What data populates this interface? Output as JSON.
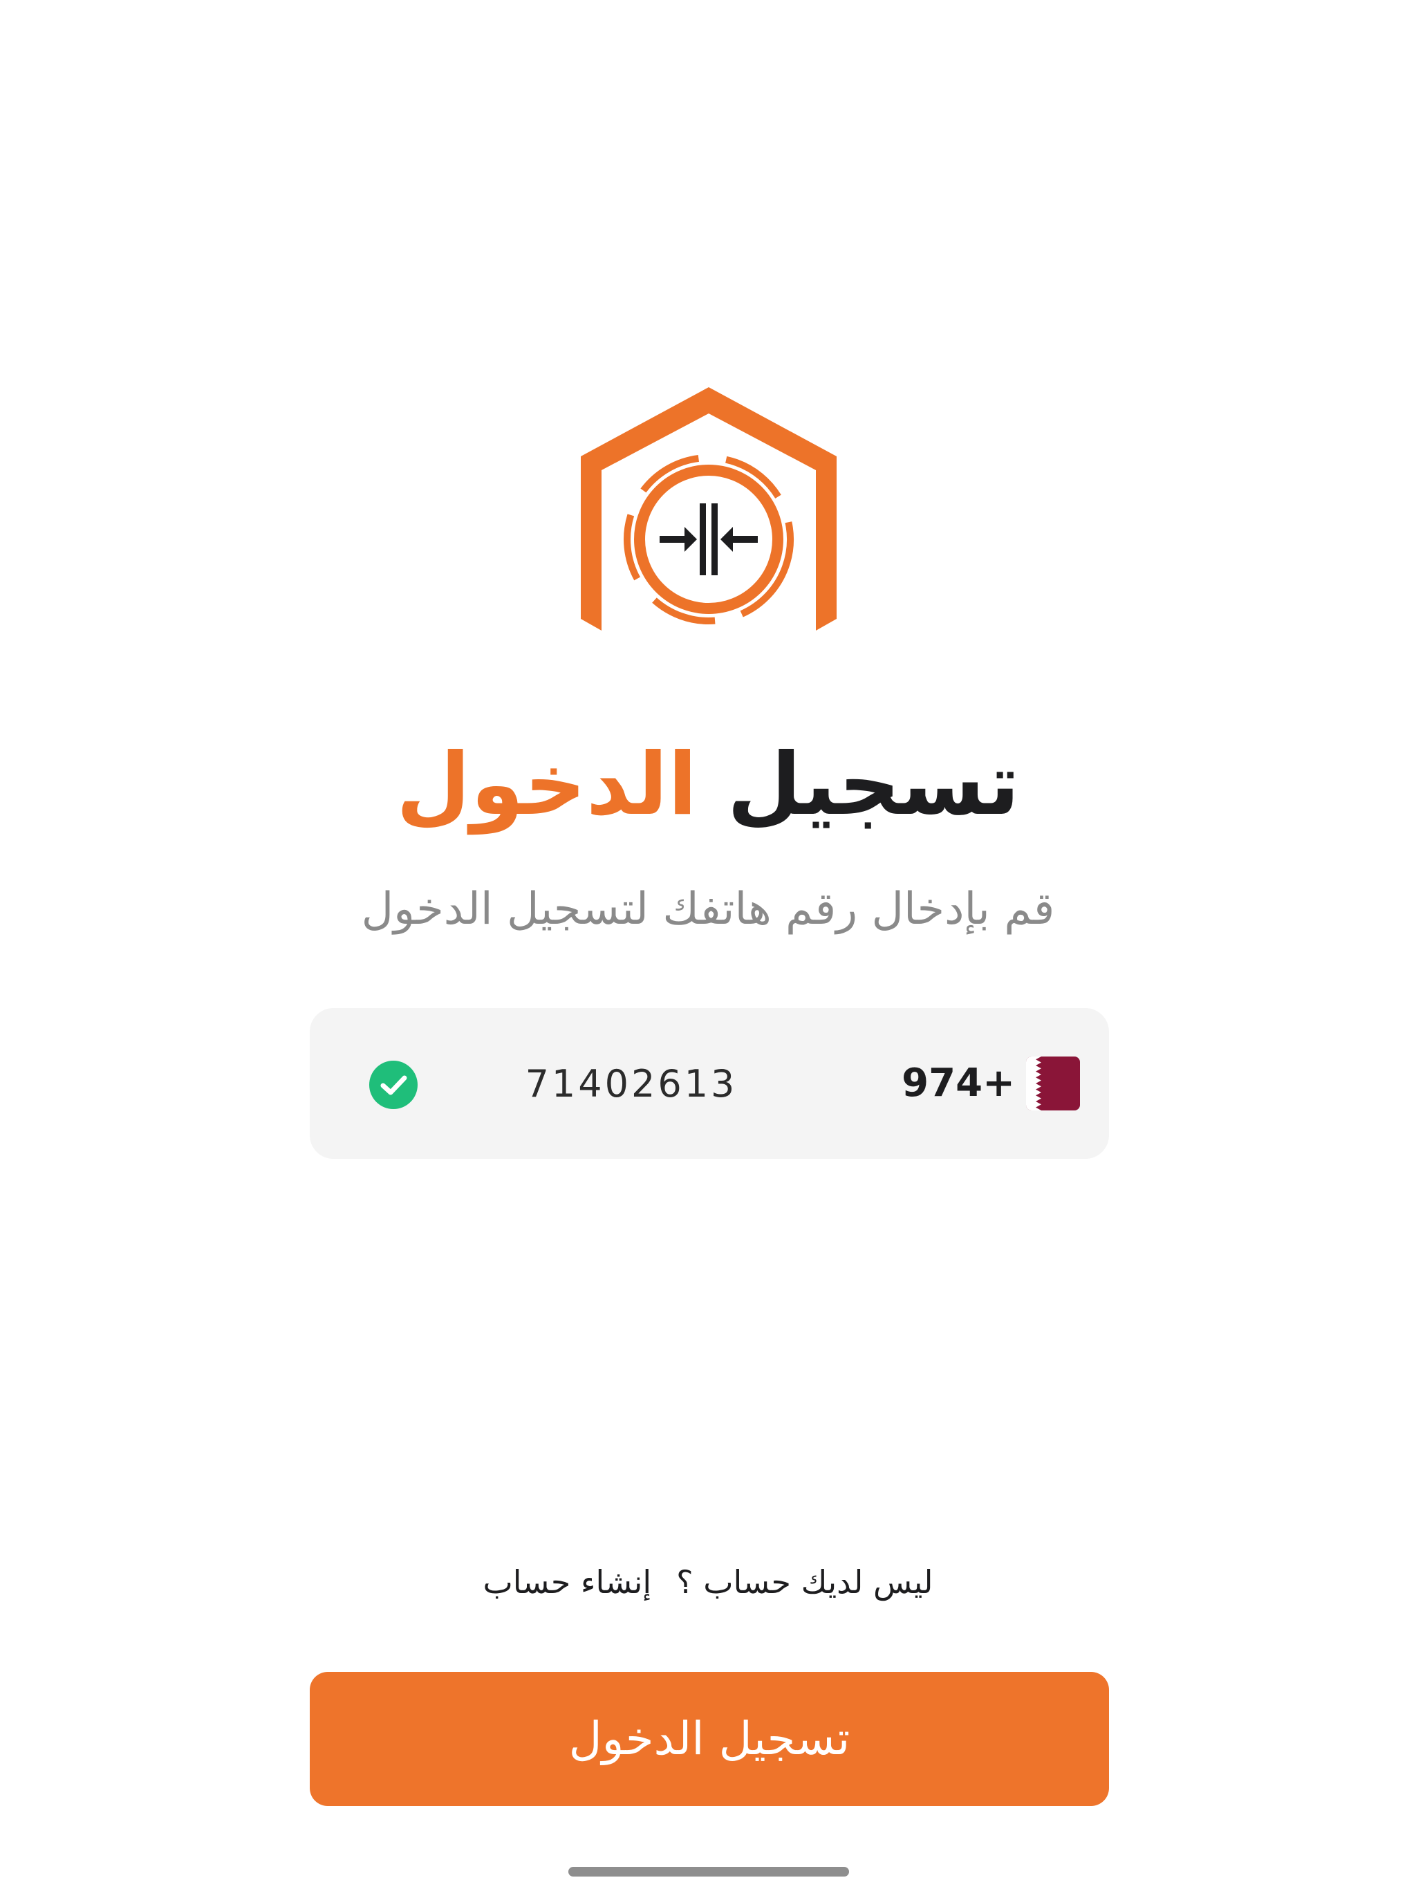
{
  "title": {
    "part1": "تسجيل",
    "part2": "الدخول"
  },
  "subtitle": "قم بإدخال رقم هاتفك لتسجيل الدخول",
  "phone": {
    "country_code": "974+",
    "number": "71402613",
    "country_flag": "qatar-flag-icon",
    "valid_icon": "check-circle-icon"
  },
  "signup": {
    "question": "ليس لديك حساب ؟",
    "link": "إنشاء حساب"
  },
  "login_button": "تسجيل الدخول",
  "colors": {
    "brand_orange": "#EE742B",
    "title_dark": "#1d1d1f",
    "subtitle_gray": "#8a8a8a",
    "field_bg": "#f4f4f4",
    "qatar_maroon": "#8A1538",
    "valid_green": "#1FBE7A"
  }
}
